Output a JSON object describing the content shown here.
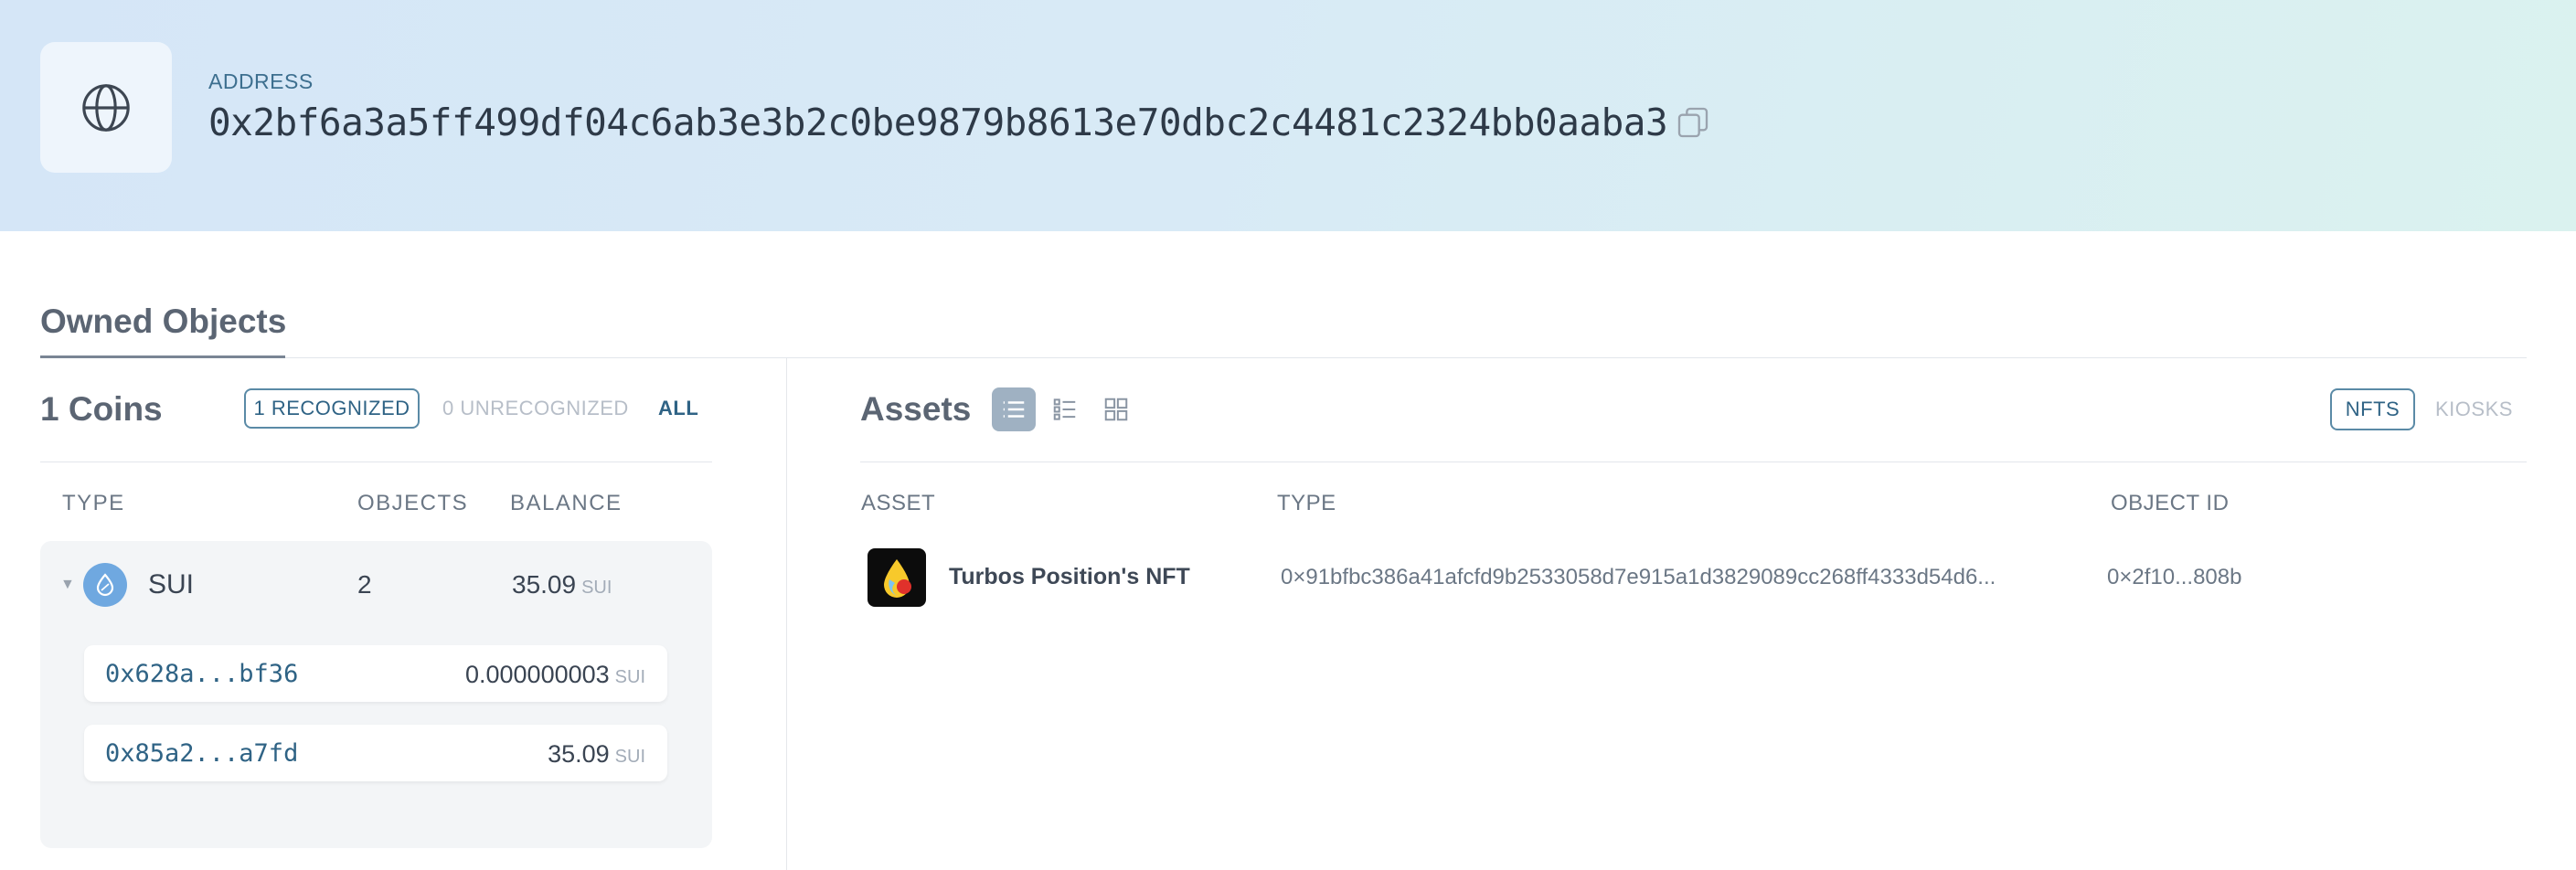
{
  "header": {
    "label": "ADDRESS",
    "address": "0x2bf6a3a5ff499df04c6ab3e3b2c0be9879b8613e70dbc2c4481c2324bb0aaba3",
    "icon": "globe-icon",
    "copy_icon": "copy-icon"
  },
  "owned_objects": {
    "title": "Owned Objects"
  },
  "coins": {
    "title": "1 Coins",
    "filters": {
      "recognized": "1 RECOGNIZED",
      "unrecognized": "0 UNRECOGNIZED",
      "all": "ALL"
    },
    "columns": [
      "TYPE",
      "OBJECTS",
      "BALANCE"
    ],
    "rows": [
      {
        "name": "SUI",
        "objects": "2",
        "balance": "35.09",
        "unit": "SUI",
        "objects_list": [
          {
            "id": "0x628a...bf36",
            "amount": "0.000000003",
            "unit": "SUI"
          },
          {
            "id": "0x85a2...a7fd",
            "amount": "35.09",
            "unit": "SUI"
          }
        ]
      }
    ]
  },
  "assets": {
    "title": "Assets",
    "view_modes": [
      "list-view-icon",
      "detailed-list-icon",
      "grid-view-icon"
    ],
    "active_view": "list-view-icon",
    "tabs": {
      "nfts": "NFTS",
      "kiosks": "KIOSKS"
    },
    "columns": [
      "ASSET",
      "TYPE",
      "OBJECT ID"
    ],
    "rows": [
      {
        "name": "Turbos Position's NFT",
        "type": "0×91bfbc386a41afcfd9b2533058d7e915a1d3829089cc268ff4333d54d6...",
        "object_id": "0×2f10...808b"
      }
    ]
  },
  "colors": {
    "accent": "#2f6385",
    "header_gradient_start": "#d5e6f7",
    "header_gradient_end": "#daf2ef",
    "sui_blue": "#6fa8e0"
  }
}
